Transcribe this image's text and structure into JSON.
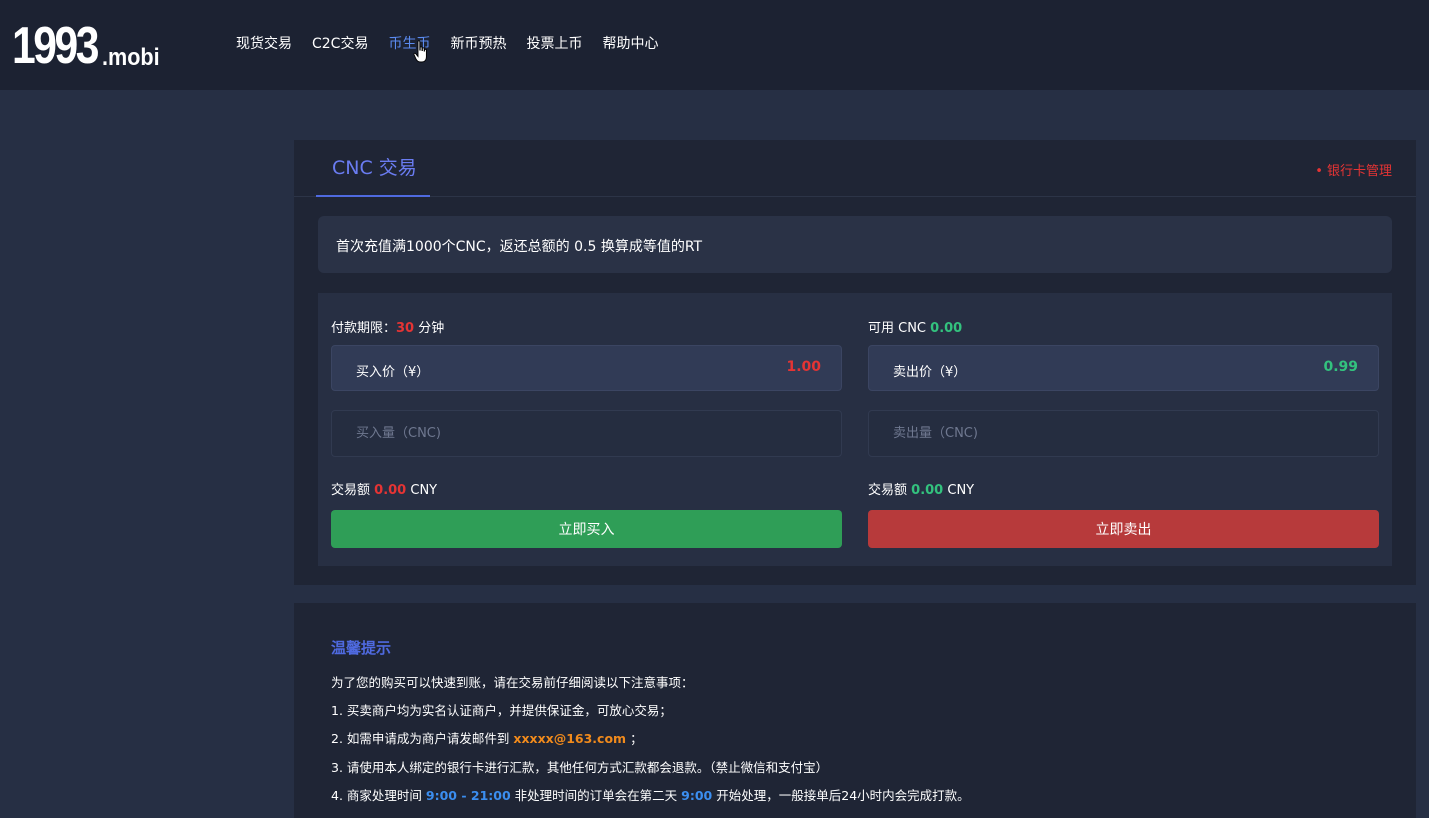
{
  "header": {
    "logo_main": "1993",
    "logo_suffix": ".mobi",
    "nav": [
      {
        "label": "现货交易"
      },
      {
        "label": "C2C交易"
      },
      {
        "label": "币生币"
      },
      {
        "label": "新币预热"
      },
      {
        "label": "投票上币"
      },
      {
        "label": "帮助中心"
      }
    ],
    "active_nav_index": 2
  },
  "trade": {
    "tab_title": "CNC 交易",
    "bank_link": "• 银行卡管理",
    "notice": "首次充值满1000个CNC，返还总额的 0.5 换算成等值的RT",
    "buy": {
      "deadline_label": "付款期限：",
      "deadline_value": "30",
      "deadline_unit": "分钟",
      "price_label": "买入价（¥）",
      "price_value": "1.00",
      "qty_placeholder": "买入量（CNC)",
      "total_label": "交易额",
      "total_value": "0.00",
      "total_unit": "CNY",
      "button": "立即买入"
    },
    "sell": {
      "available_label": "可用 CNC",
      "available_value": "0.00",
      "price_label": "卖出价（¥）",
      "price_value": "0.99",
      "qty_placeholder": "卖出量（CNC)",
      "total_label": "交易额",
      "total_value": "0.00",
      "total_unit": "CNY",
      "button": "立即卖出"
    }
  },
  "tips": {
    "title": "温馨提示",
    "intro": "为了您的购买可以快速到账，请在交易前仔细阅读以下注意事项：",
    "line1": "1. 买卖商户均为实名认证商户，并提供保证金，可放心交易；",
    "line2_prefix": "2. 如需申请成为商户请发邮件到",
    "line2_email": "xxxxx@163.com",
    "line2_suffix": "；",
    "line3": "3. 请使用本人绑定的银行卡进行汇款，其他任何方式汇款都会退款。（禁止微信和支付宝）",
    "line4_prefix": "4. 商家处理时间",
    "line4_hours": "9:00 - 21:00",
    "line4_mid": "非处理时间的订单会在第二天",
    "line4_start": "9:00",
    "line4_suffix": "开始处理，一般接单后24小时内会完成打款。"
  },
  "colors": {
    "accent": "#4f6ae0",
    "buy": "#2f9e57",
    "sell": "#b73a3b",
    "price_red": "#e53434",
    "price_green": "#33c27e"
  }
}
